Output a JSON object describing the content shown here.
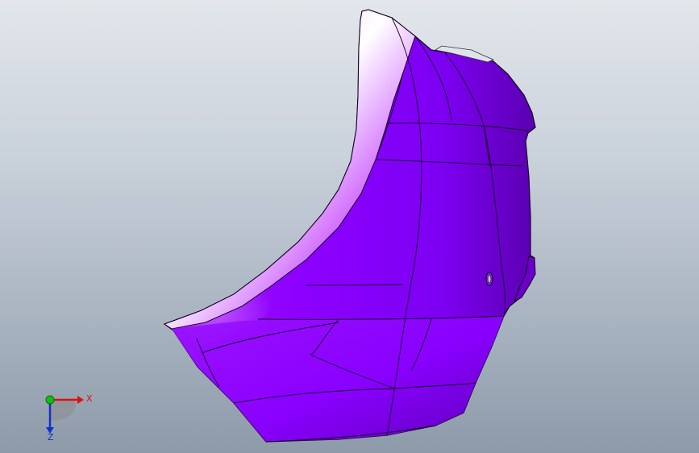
{
  "viewport": {
    "background_top": "#e3e7ec",
    "background_bottom": "#8d9aa9"
  },
  "model": {
    "part": "bumper-panel",
    "color": "#8a00ff",
    "highlight_color": "#fbe8ff",
    "edge_color": "#140028"
  },
  "triad": {
    "x_label": "X",
    "z_label": "Z",
    "x_color": "#e01010",
    "y_color": "#10c010",
    "z_color": "#1030d0"
  }
}
